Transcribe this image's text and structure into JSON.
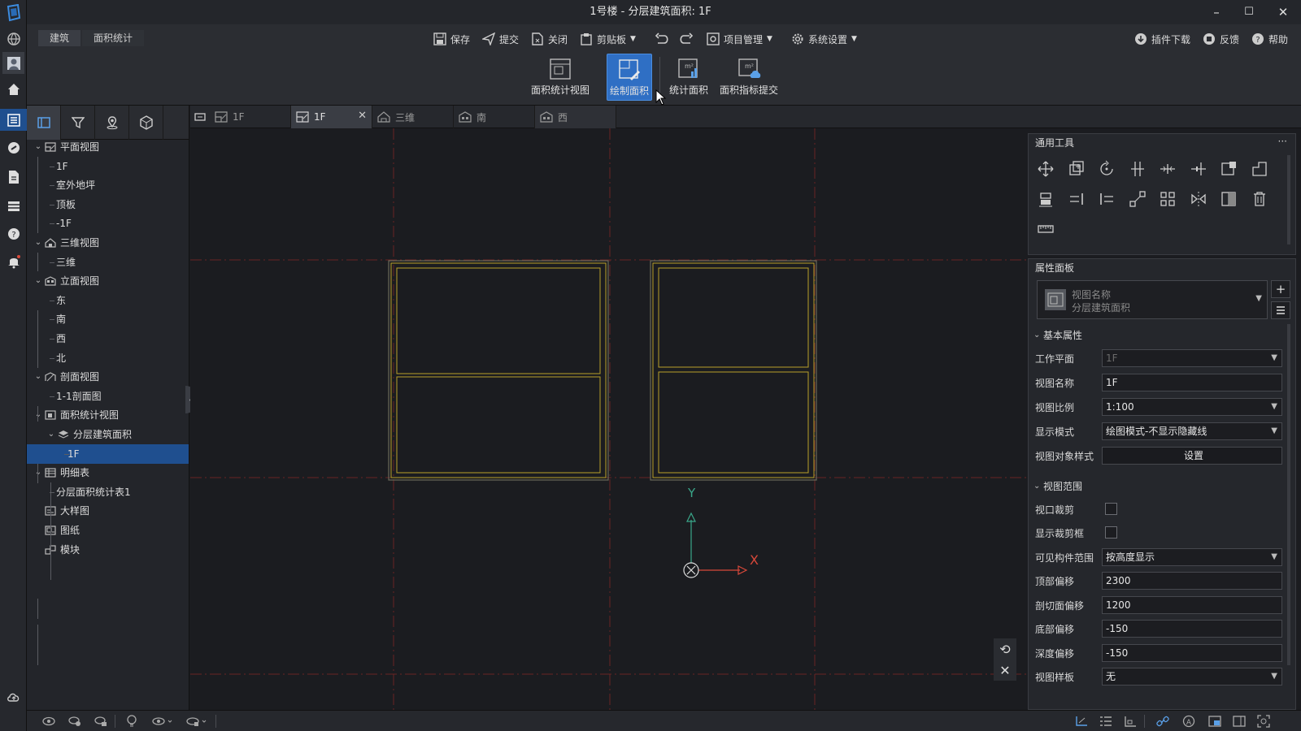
{
  "window": {
    "title": "1号楼 - 分层建筑面积: 1F",
    "minimize": "–",
    "maximize": "☐",
    "close": "✕"
  },
  "breadcrumb": [
    "建筑",
    "面积统计"
  ],
  "toolbar": {
    "save": "保存",
    "submit": "提交",
    "close": "关闭",
    "clipboard": "剪贴板",
    "project": "项目管理",
    "settings": "系统设置",
    "plugin": "插件下载",
    "feedback": "反馈",
    "help": "帮助"
  },
  "ribbon": [
    {
      "label": "面积统计视图",
      "active": false
    },
    {
      "label": "绘制面积",
      "active": true
    },
    {
      "label": "统计面积",
      "active": false
    },
    {
      "label": "面积指标提交",
      "active": false
    }
  ],
  "tree": [
    {
      "label": "平面视图",
      "level": 0,
      "expand": true,
      "icon": "plan-view-icon"
    },
    {
      "label": "1F",
      "level": 1
    },
    {
      "label": "室外地坪",
      "level": 1
    },
    {
      "label": "顶板",
      "level": 1
    },
    {
      "label": "-1F",
      "level": 1
    },
    {
      "label": "三维视图",
      "level": 0,
      "expand": true,
      "icon": "3d-view-icon"
    },
    {
      "label": "三维",
      "level": 1
    },
    {
      "label": "立面视图",
      "level": 0,
      "expand": true,
      "icon": "elevation-view-icon"
    },
    {
      "label": "东",
      "level": 1
    },
    {
      "label": "南",
      "level": 1
    },
    {
      "label": "西",
      "level": 1
    },
    {
      "label": "北",
      "level": 1
    },
    {
      "label": "剖面视图",
      "level": 0,
      "expand": true,
      "icon": "section-view-icon"
    },
    {
      "label": "1-1剖面图",
      "level": 1
    },
    {
      "label": "面积统计视图",
      "level": 0,
      "expand": true,
      "icon": "area-view-icon"
    },
    {
      "label": "分层建筑面积",
      "level": 1,
      "expand": true,
      "icon": "layers-icon"
    },
    {
      "label": "1F",
      "level": 2,
      "selected": true
    },
    {
      "label": "明细表",
      "level": 0,
      "expand": true,
      "icon": "schedule-icon"
    },
    {
      "label": "分层面积统计表1",
      "level": 1
    },
    {
      "label": "大样图",
      "level": 0,
      "icon": "detail-icon"
    },
    {
      "label": "图纸",
      "level": 0,
      "icon": "sheet-icon"
    },
    {
      "label": "模块",
      "level": 0,
      "icon": "module-icon"
    }
  ],
  "view_tabs": [
    {
      "label": "1F",
      "active": false,
      "icon": "plan-tab-icon"
    },
    {
      "label": "1F",
      "active": true,
      "icon": "area-tab-icon",
      "closable": true
    },
    {
      "label": "三维",
      "active": false,
      "icon": "3d-tab-icon"
    },
    {
      "label": "南",
      "active": false,
      "icon": "elevation-tab-icon"
    },
    {
      "label": "西",
      "active": false,
      "icon": "elevation-tab-icon"
    }
  ],
  "canvas": {
    "axis_y": "Y",
    "axis_x": "X"
  },
  "tools_panel": {
    "title": "通用工具",
    "more": "···"
  },
  "properties": {
    "title": "属性面板",
    "view_name_caption": "视图名称",
    "view_type": "分层建筑面积",
    "section_basic": "基本属性",
    "section_range": "视图范围",
    "rows": {
      "workplane": {
        "label": "工作平面",
        "value": "1F"
      },
      "viewname": {
        "label": "视图名称",
        "value": "1F"
      },
      "scale": {
        "label": "视图比例",
        "value": "1:100"
      },
      "display": {
        "label": "显示模式",
        "value": "绘图模式-不显示隐藏线"
      },
      "style": {
        "label": "视图对象样式",
        "value": "设置"
      },
      "crop": {
        "label": "视口裁剪"
      },
      "cropbox": {
        "label": "显示裁剪框"
      },
      "visible": {
        "label": "可见构件范围",
        "value": "按高度显示"
      },
      "top": {
        "label": "顶部偏移",
        "value": "2300"
      },
      "cut": {
        "label": "剖切面偏移",
        "value": "1200"
      },
      "bottom": {
        "label": "底部偏移",
        "value": "-150"
      },
      "depth": {
        "label": "深度偏移",
        "value": "-150"
      },
      "template": {
        "label": "视图样板",
        "value": "无"
      }
    }
  },
  "colors": {
    "accent": "#1f4f8f",
    "highlight": "#2f6fc4",
    "area_line": "#b8a12a",
    "axis_y": "#3aa78a",
    "axis_x": "#d8483a",
    "grid": "#6a2424"
  }
}
